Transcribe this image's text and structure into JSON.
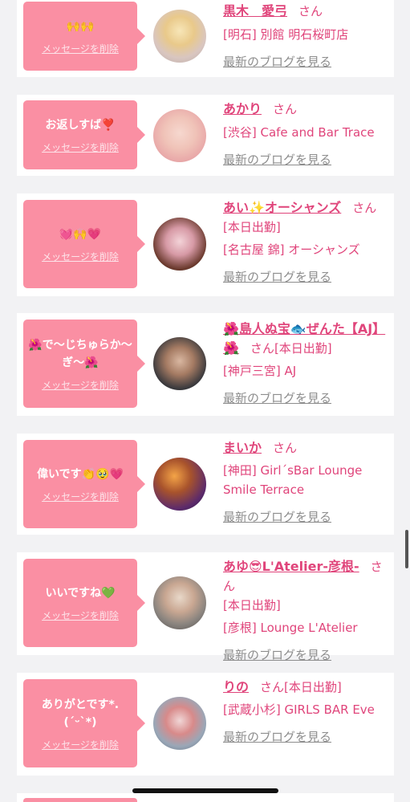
{
  "delete_label": "メッセージを削除",
  "blog_label": "最新のブログを見る",
  "san": "さん",
  "colors": {
    "accent": "#e0457b",
    "bubble": "#fa8fa3",
    "muted": "#8d8d8d"
  },
  "items": [
    {
      "message": "🙌🙌",
      "name": "黒木　愛弓",
      "tag": "",
      "shop": "[明石] 別館 明石桜町店"
    },
    {
      "message": "お返しすば❣️",
      "name": "あかり",
      "tag": "",
      "shop": "[渋谷] Cafe and Bar Trace"
    },
    {
      "message": "💓🙌💗",
      "name": "あい✨オーシャンズ",
      "tag": "[本日出勤]",
      "shop": "[名古屋 錦] オーシャンズ"
    },
    {
      "message": "🌺で〜じちゅらか〜ぎ〜🌺",
      "name": "🌺島人ぬ宝🐟ぜんた【AJ】🌺",
      "tag": "[本日出勤]",
      "shop": "[神戸三宮] AJ"
    },
    {
      "message": "偉いです👏🥹💗",
      "name": "まいか",
      "tag": "",
      "shop": "[神田] Girl´sBar Lounge Smile Terrace"
    },
    {
      "message": "いいですね💚",
      "name": "あゆ😎L'Atelier-彦根-",
      "tag": "[本日出勤]",
      "shop": "[彦根] Lounge L'Atelier"
    },
    {
      "message": "ありがとです*.(ˊᵕˋ*)",
      "name": "りの",
      "tag": "[本日出勤]",
      "shop": "[武蔵小杉] GIRLS BAR Eve"
    }
  ]
}
